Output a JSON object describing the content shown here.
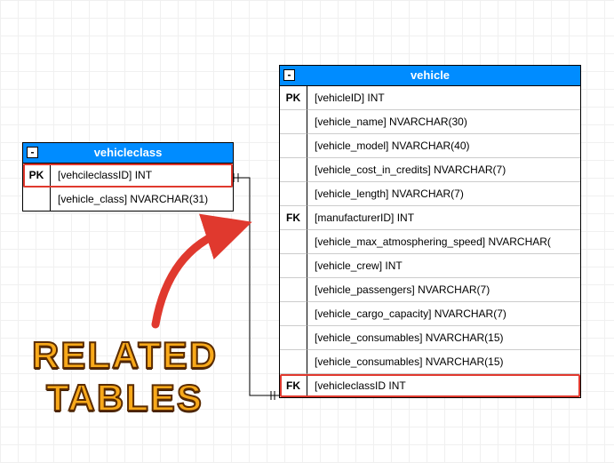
{
  "label_line1": "Related",
  "label_line2": "Tables",
  "collapse_glyph": "-",
  "tables": {
    "vehicleclass": {
      "title": "vehicleclass",
      "rows": [
        {
          "key": "PK",
          "col": "[vehcileclassID] INT",
          "hl": true
        },
        {
          "key": "",
          "col": "[vehicle_class] NVARCHAR(31)",
          "hl": false
        }
      ]
    },
    "vehicle": {
      "title": "vehicle",
      "rows": [
        {
          "key": "PK",
          "col": "[vehicleID] INT",
          "hl": false
        },
        {
          "key": "",
          "col": "[vehicle_name] NVARCHAR(30)",
          "hl": false
        },
        {
          "key": "",
          "col": "[vehicle_model] NVARCHAR(40)",
          "hl": false
        },
        {
          "key": "",
          "col": "[vehicle_cost_in_credits] NVARCHAR(7)",
          "hl": false
        },
        {
          "key": "",
          "col": "[vehicle_length] NVARCHAR(7)",
          "hl": false
        },
        {
          "key": "FK",
          "col": "[manufacturerID] INT",
          "hl": false
        },
        {
          "key": "",
          "col": "[vehicle_max_atmosphering_speed] NVARCHAR(",
          "hl": false
        },
        {
          "key": "",
          "col": "[vehicle_crew] INT",
          "hl": false
        },
        {
          "key": "",
          "col": "[vehicle_passengers] NVARCHAR(7)",
          "hl": false
        },
        {
          "key": "",
          "col": "[vehicle_cargo_capacity] NVARCHAR(7)",
          "hl": false
        },
        {
          "key": "",
          "col": "[vehicle_consumables] NVARCHAR(15)",
          "hl": false
        },
        {
          "key": "",
          "col": "[vehicle_consumables] NVARCHAR(15)",
          "hl": false
        },
        {
          "key": "FK",
          "col": "[vehicleclassID INT",
          "hl": true
        }
      ]
    }
  }
}
